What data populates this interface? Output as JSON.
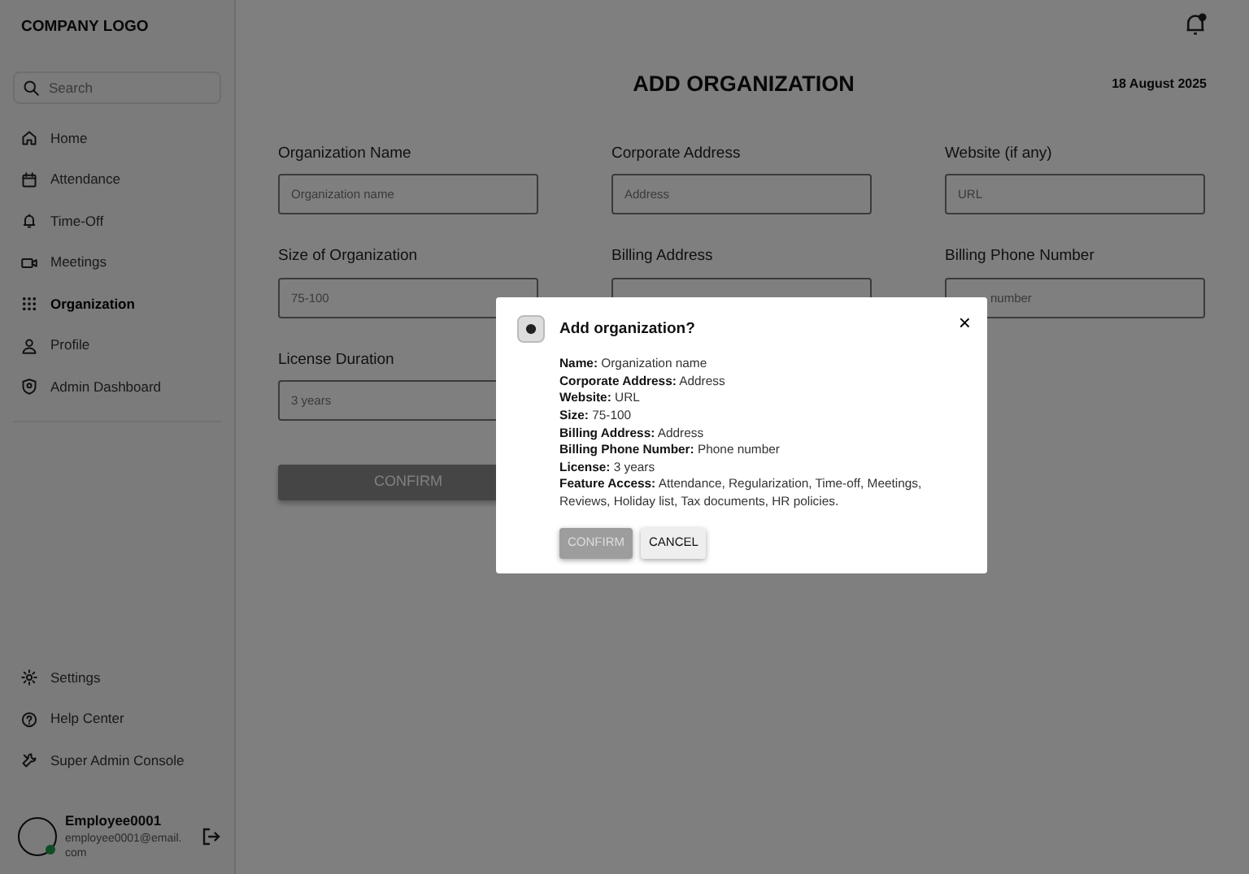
{
  "sidebar": {
    "logo": "COMPANY LOGO",
    "search": {
      "placeholder": "Search"
    },
    "items": [
      {
        "label": "Home",
        "selected": false
      },
      {
        "label": "Attendance",
        "selected": false
      },
      {
        "label": "Time-Off",
        "selected": false
      },
      {
        "label": "Meetings",
        "selected": false
      },
      {
        "label": "Organization",
        "selected": true
      },
      {
        "label": "Profile",
        "selected": false
      },
      {
        "label": "Admin Dashboard",
        "selected": false
      }
    ],
    "bottom_items": [
      {
        "label": "Settings"
      },
      {
        "label": "Help Center"
      },
      {
        "label": "Super Admin Console"
      }
    ],
    "user": {
      "name": "Employee0001",
      "email": "employee0001@email.com",
      "online": true
    }
  },
  "header": {
    "title": "ADD ORGANIZATION",
    "date": "18 August 2025"
  },
  "form": {
    "fields": [
      {
        "label": "Organization Name",
        "placeholder": "Organization name"
      },
      {
        "label": "Corporate Address",
        "placeholder": "Address"
      },
      {
        "label": "Website (if any)",
        "placeholder": "URL"
      },
      {
        "label": "Size of Organization",
        "placeholder": "75-100"
      },
      {
        "label": "Billing Address"
      },
      {
        "label": "Billing Phone Number",
        "placeholder": "number",
        "partly_covered": true
      },
      {
        "label": "License Duration",
        "placeholder": "3 years"
      }
    ],
    "confirm": "CONFIRM"
  },
  "dialog": {
    "title": "Add organization?",
    "close": "×",
    "lines": [
      "**Name:** Organization name",
      "**Corporate Address:** Address",
      "**Website:** URL",
      "**Size:** 75-100",
      "**Billing Address:** Address",
      "**Billing Phone Number:** Phone number",
      "**License:** 3 years",
      "**Feature Access:** Attendance, Regularization, Time-off, Meetings, Reviews, Holiday list, Tax documents, HR policies."
    ],
    "buttons": [
      {
        "label": "CONFIRM",
        "disabled": true
      },
      {
        "label": "CANCEL",
        "disabled": false
      }
    ]
  }
}
